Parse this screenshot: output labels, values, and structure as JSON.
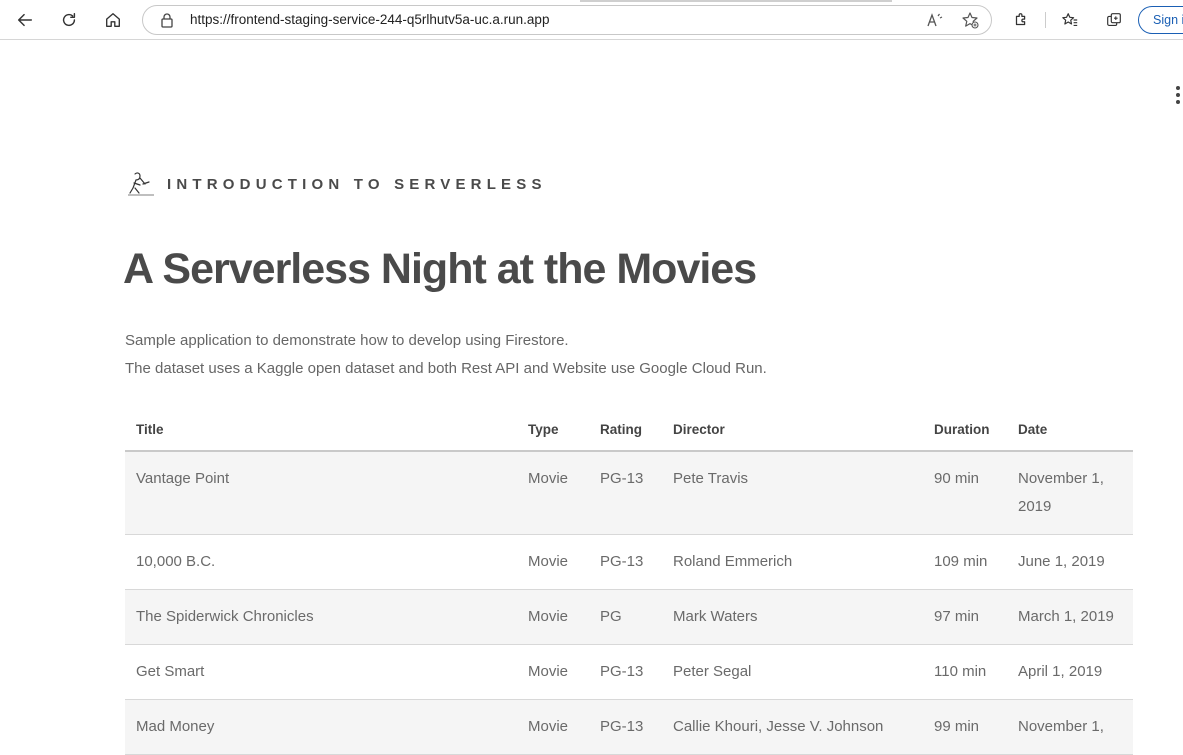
{
  "browser": {
    "url": "https://frontend-staging-service-244-q5rlhutv5a-uc.a.run.app",
    "sign_in_label": "Sign in",
    "icons": [
      "back-icon",
      "reload-icon",
      "home-icon",
      "lock-icon",
      "read-aloud-icon",
      "add-favorite-icon",
      "extensions-icon",
      "favorites-icon",
      "collections-icon"
    ]
  },
  "header": {
    "brand_text": "INTRODUCTION TO SERVERLESS"
  },
  "main": {
    "title": "A Serverless Night at the Movies",
    "description_line1": "Sample application to demonstrate how to develop using Firestore.",
    "description_line2": "The dataset uses a Kaggle open dataset and both Rest API and Website use Google Cloud Run."
  },
  "table": {
    "columns": [
      "Title",
      "Type",
      "Rating",
      "Director",
      "Duration",
      "Date"
    ],
    "rows": [
      [
        "Vantage Point",
        "Movie",
        "PG-13",
        "Pete Travis",
        "90 min",
        "November 1, 2019"
      ],
      [
        "10,000 B.C.",
        "Movie",
        "PG-13",
        "Roland Emmerich",
        "109 min",
        "June 1, 2019"
      ],
      [
        "The Spiderwick Chronicles",
        "Movie",
        "PG",
        "Mark Waters",
        "97 min",
        "March 1, 2019"
      ],
      [
        "Get Smart",
        "Movie",
        "PG-13",
        "Peter Segal",
        "110 min",
        "April 1, 2019"
      ],
      [
        "Mad Money",
        "Movie",
        "PG-13",
        "Callie Khouri, Jesse V. Johnson",
        "99 min",
        "November 1,"
      ]
    ]
  },
  "colors": {
    "heading": "#4a4a4a",
    "body_text": "#666666",
    "row_stripe": "#f5f5f5",
    "sign_in_accent": "#1a5fb4"
  }
}
